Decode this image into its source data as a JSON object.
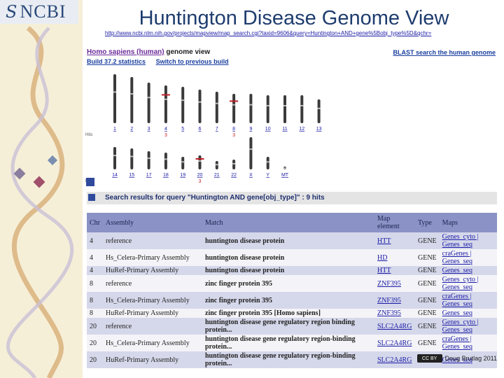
{
  "logo": {
    "mark": "S",
    "text": "NCBI"
  },
  "title": "Huntington Disease Genome View",
  "url": "http://www.ncbi.nlm.nih.gov/projects/mapview/map_search.cgi?taxid=9606&query=Huntington+AND+gene%5Bobj_type%5D&qchr=",
  "genome_view": {
    "species": "Homo sapiens (human)",
    "suffix": " genome view",
    "build": "Build 37.2 statistics",
    "switch": "Switch to previous build",
    "blast": "BLAST search the human genome",
    "hits_label": "Hits",
    "row1": [
      {
        "chr": "1",
        "hits": ""
      },
      {
        "chr": "2",
        "hits": ""
      },
      {
        "chr": "3",
        "hits": ""
      },
      {
        "chr": "4",
        "hits": "3"
      },
      {
        "chr": "5",
        "hits": ""
      },
      {
        "chr": "6",
        "hits": ""
      },
      {
        "chr": "7",
        "hits": ""
      },
      {
        "chr": "8",
        "hits": "3"
      },
      {
        "chr": "9",
        "hits": ""
      },
      {
        "chr": "10",
        "hits": ""
      },
      {
        "chr": "11",
        "hits": ""
      },
      {
        "chr": "12",
        "hits": ""
      },
      {
        "chr": "13",
        "hits": ""
      }
    ],
    "row2": [
      {
        "chr": "14",
        "hits": ""
      },
      {
        "chr": "15",
        "hits": ""
      },
      {
        "chr": "17",
        "hits": ""
      },
      {
        "chr": "18",
        "hits": ""
      },
      {
        "chr": "19",
        "hits": ""
      },
      {
        "chr": "20",
        "hits": "3"
      },
      {
        "chr": "21",
        "hits": ""
      },
      {
        "chr": "22",
        "hits": ""
      },
      {
        "chr": "X",
        "hits": ""
      },
      {
        "chr": "Y",
        "hits": ""
      },
      {
        "chr": "MT",
        "hits": ""
      }
    ]
  },
  "search": {
    "text": "Search results for query \"Huntington AND gene[obj_type]\" :   9 hits"
  },
  "table": {
    "headers": [
      "Chr",
      "Assembly",
      "Match",
      "Map element",
      "Type",
      "Maps"
    ],
    "rows": [
      {
        "chr": "4",
        "assembly": "reference",
        "match": "huntington disease protein",
        "element": "HTT",
        "type": "GENE",
        "maps": "Genes_cyto | Genes_seq"
      },
      {
        "chr": "4",
        "assembly": "Hs_Celera-Primary Assembly",
        "match": "huntington disease protein",
        "element": "HD",
        "type": "GENE",
        "maps": "craGenes | Genes_seq"
      },
      {
        "chr": "4",
        "assembly": "HuRef-Primary Assembly",
        "match": "huntington disease protein",
        "element": "HTT",
        "type": "GENE",
        "maps": "Genes_seq"
      },
      {
        "chr": "8",
        "assembly": "reference",
        "match": "zinc finger protein 395",
        "element": "ZNF395",
        "type": "GENE",
        "maps": "Genes_cyto | Genes_seq"
      },
      {
        "chr": "8",
        "assembly": "Hs_Celera-Primary Assembly",
        "match": "zinc finger protein 395",
        "element": "ZNF395",
        "type": "GENE",
        "maps": "craGenes | Genes_seq"
      },
      {
        "chr": "8",
        "assembly": "HuRef-Primary Assembly",
        "match": "zinc finger protein 395 [Homo sapiens]",
        "element": "ZNF395",
        "type": "GENE",
        "maps": "Genes_seq"
      },
      {
        "chr": "20",
        "assembly": "reference",
        "match": "huntington disease gene regulatory region binding protein...",
        "element": "SLC2A4RG",
        "type": "GENE",
        "maps": "Genes_cyto | Genes_seq"
      },
      {
        "chr": "20",
        "assembly": "Hs_Celera-Primary Assembly",
        "match": "huntington disease gene regulatory region-binding protein...",
        "element": "SLC2A4RG",
        "type": "GENE",
        "maps": "craGenes | Genes_seq"
      },
      {
        "chr": "20",
        "assembly": "HuRef-Primary Assembly",
        "match": "huntington disease gene regulatory region-binding protein...",
        "element": "SLC2A4RG",
        "type": "GENE",
        "maps": "Genes_seq"
      }
    ]
  },
  "footer": {
    "license": "CC BY",
    "credit": "Doug Brutlag 2011"
  }
}
